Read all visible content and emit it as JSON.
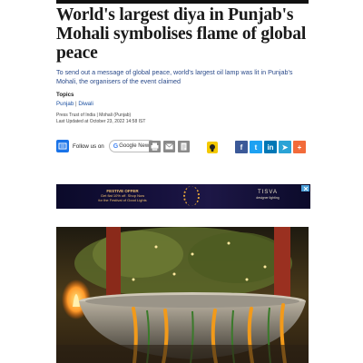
{
  "article": {
    "headline": "World's largest diya in Punjab's Mohali symbolises flame of global peace",
    "summary": "To send out a message of global peace, world's largest oil lamp was lit in Punjab's Mohali, the organisers of the event claimed",
    "topics_heading": "Topics",
    "topics": [
      "Punjab",
      "Diwali"
    ],
    "topics_separator": "|",
    "source": "Press Trust of India",
    "byline_separator": "|",
    "location": "Mohali (Punjab)",
    "updated": "Last Updated at October 23, 2022 14:58 IST"
  },
  "follow": {
    "label": "Follow us on",
    "google_news_label": "Google News",
    "google_news_initial": "G"
  },
  "share": {
    "facebook": "f",
    "twitter": "t",
    "linkedin": "in",
    "telegram": "➤",
    "more": "+"
  },
  "ad": {
    "left_line1": "FESTIVE OFFER",
    "left_line2": "Get flat 10% off. Shop Now",
    "left_line3": "for the Festival of Good Lights",
    "right_brand": "TISVA",
    "right_tag": "designer lighting"
  },
  "colors": {
    "facebook": "#3b5998",
    "twitter": "#1da1f2",
    "linkedin": "#0077b5",
    "telegram": "#2aa3d6",
    "more": "#f26b3a",
    "topic_link": "#1a4fa0"
  }
}
